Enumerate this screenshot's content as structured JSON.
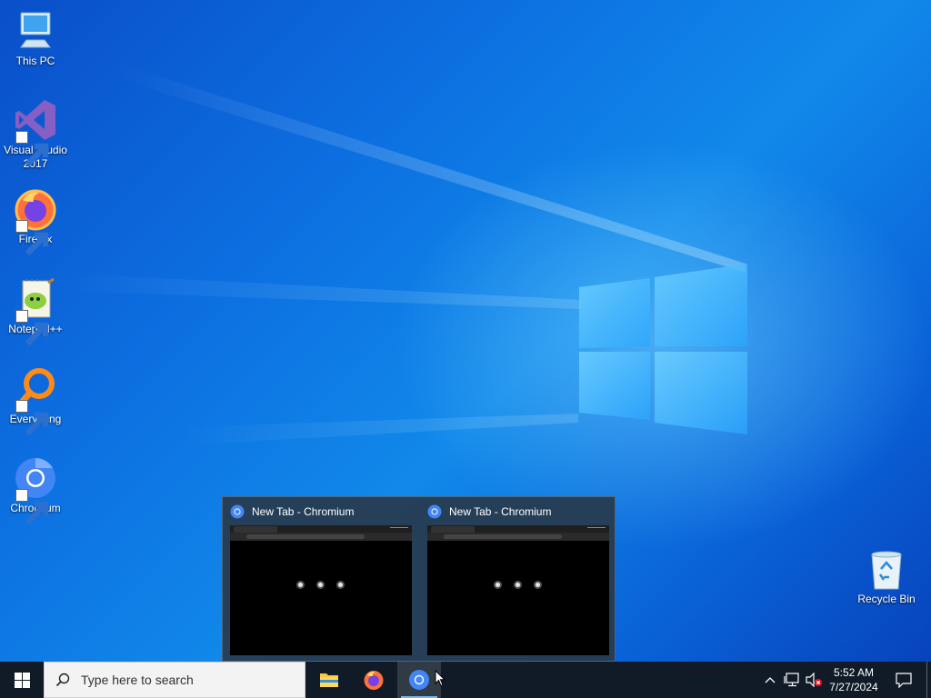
{
  "desktop": {
    "icons": [
      {
        "label": "This PC",
        "icon": "monitor-icon",
        "shortcut": false
      },
      {
        "label": "Visual Studio 2017",
        "icon": "visual-studio-icon",
        "shortcut": true
      },
      {
        "label": "Firefox",
        "icon": "firefox-icon",
        "shortcut": true
      },
      {
        "label": "Notepad++",
        "icon": "notepad-plus-plus-icon",
        "shortcut": true
      },
      {
        "label": "Everything",
        "icon": "everything-search-icon",
        "shortcut": true
      },
      {
        "label": "Chromium",
        "icon": "chromium-icon",
        "shortcut": true
      }
    ],
    "recycle_bin": {
      "label": "Recycle Bin",
      "icon": "recycle-bin-icon"
    }
  },
  "preview": {
    "windows": [
      {
        "title": "New Tab - Chromium"
      },
      {
        "title": "New Tab - Chromium"
      }
    ]
  },
  "taskbar": {
    "search_placeholder": "Type here to search",
    "pinned": [
      {
        "name": "file-explorer",
        "active": false
      },
      {
        "name": "firefox",
        "active": false
      },
      {
        "name": "chromium",
        "active": true
      }
    ],
    "tray": {
      "time": "5:52 AM",
      "date": "7/27/2024"
    }
  },
  "colors": {
    "taskbar": "#101b27",
    "accent": "#76b9ed",
    "chromium_blue": "#4285f4"
  }
}
